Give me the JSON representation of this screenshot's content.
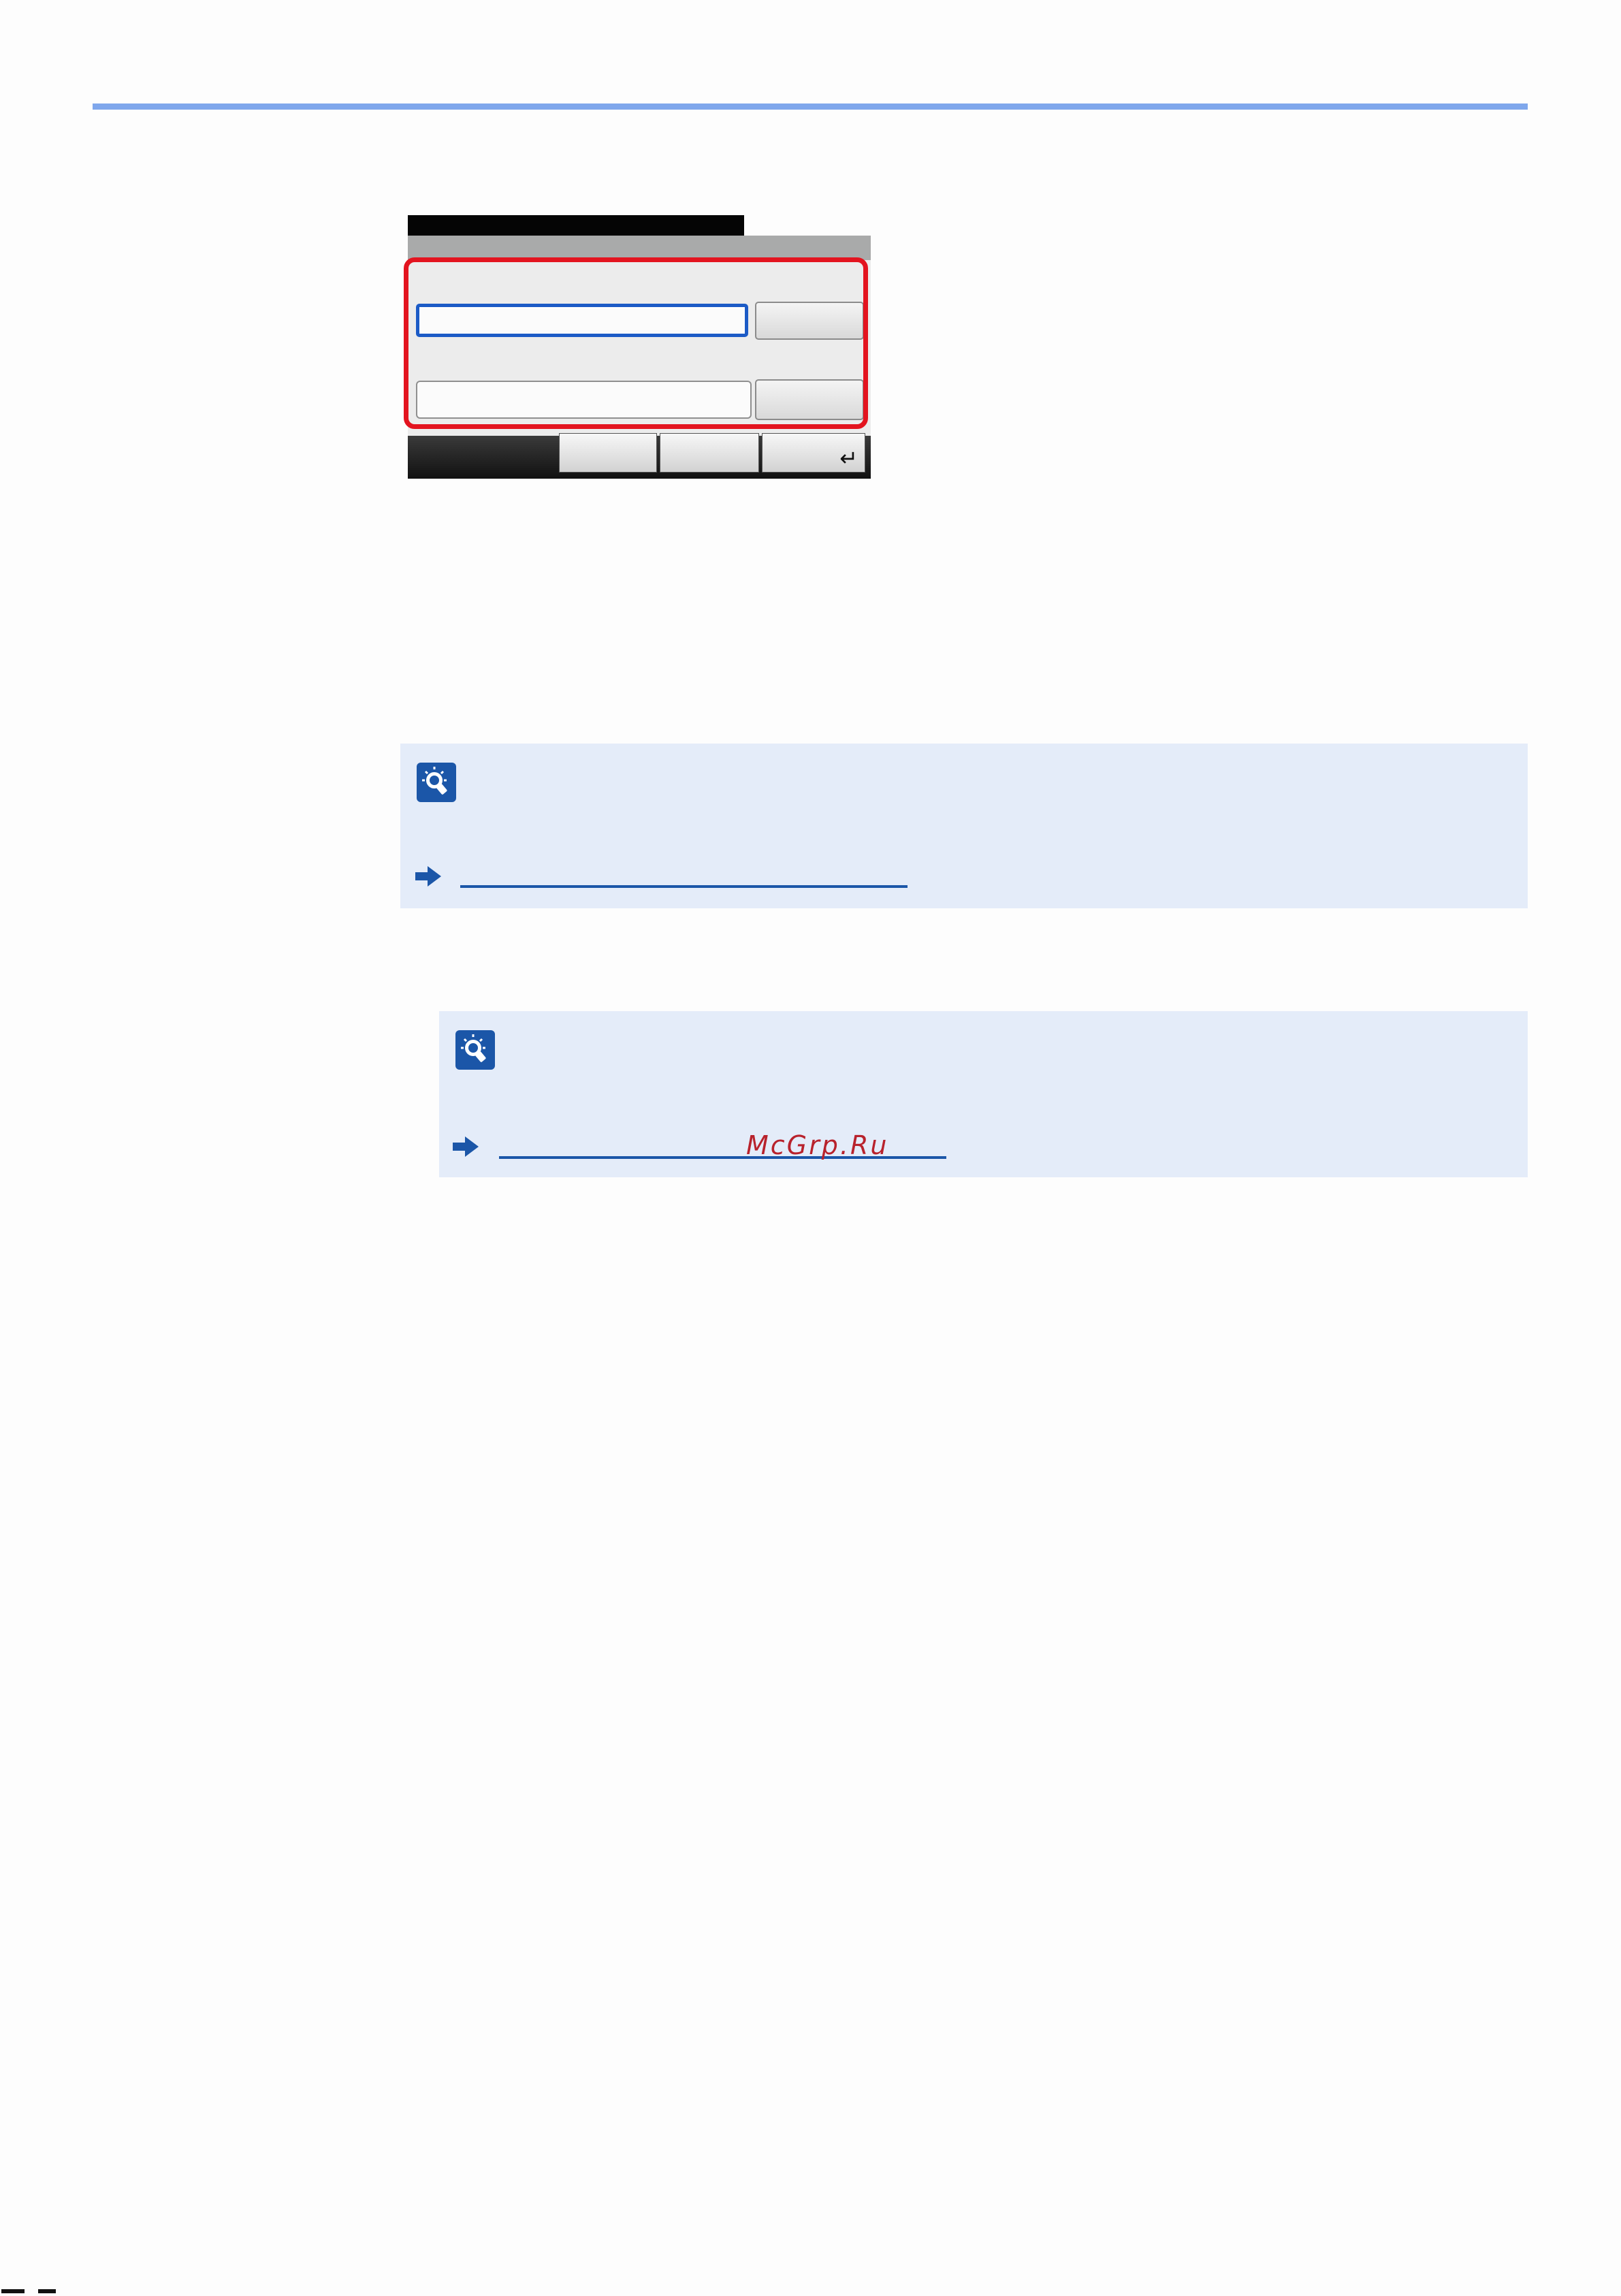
{
  "watermark": "McGrp.Ru",
  "colors": {
    "rule": "#7fa7ec",
    "highlight": "#e3141f",
    "note_bg": "#e4ecf9",
    "accent": "#1b56a8"
  },
  "icons": {
    "note": "lightbulb-hint-icon",
    "reference": "right-arrow-icon",
    "enter": "enter-return-icon"
  }
}
